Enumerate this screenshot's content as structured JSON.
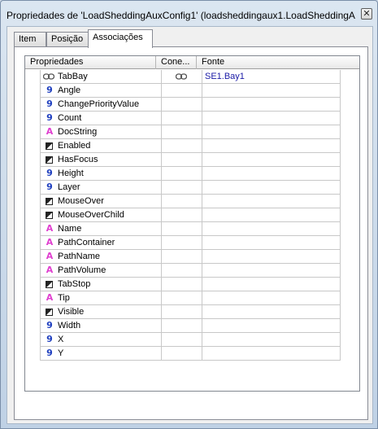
{
  "window": {
    "title": "Propriedades de 'LoadSheddingAuxConfig1' (loadsheddingaux1.LoadSheddingA...",
    "close_glyph": "✕"
  },
  "tabs": [
    {
      "label": "Item"
    },
    {
      "label": "Posição"
    },
    {
      "label": "Associações"
    }
  ],
  "grid": {
    "columns": [
      "Propriedades",
      "Cone...",
      "Fonte"
    ],
    "rows": [
      {
        "name": "TabBay",
        "icon": "link-icon",
        "connected": true,
        "source": "SE1.Bay1"
      },
      {
        "name": "Angle",
        "icon": "number-icon",
        "source": ""
      },
      {
        "name": "ChangePriorityValue",
        "icon": "number-icon",
        "source": ""
      },
      {
        "name": "Count",
        "icon": "number-icon",
        "source": ""
      },
      {
        "name": "DocString",
        "icon": "string-icon",
        "source": ""
      },
      {
        "name": "Enabled",
        "icon": "boolean-icon",
        "source": ""
      },
      {
        "name": "HasFocus",
        "icon": "boolean-icon",
        "source": ""
      },
      {
        "name": "Height",
        "icon": "number-icon",
        "source": ""
      },
      {
        "name": "Layer",
        "icon": "number-icon",
        "source": ""
      },
      {
        "name": "MouseOver",
        "icon": "boolean-icon",
        "source": ""
      },
      {
        "name": "MouseOverChild",
        "icon": "boolean-icon",
        "source": ""
      },
      {
        "name": "Name",
        "icon": "string-icon",
        "source": ""
      },
      {
        "name": "PathContainer",
        "icon": "string-icon",
        "source": ""
      },
      {
        "name": "PathName",
        "icon": "string-icon",
        "source": ""
      },
      {
        "name": "PathVolume",
        "icon": "string-icon",
        "source": ""
      },
      {
        "name": "TabStop",
        "icon": "boolean-icon",
        "source": ""
      },
      {
        "name": "Tip",
        "icon": "string-icon",
        "source": ""
      },
      {
        "name": "Visible",
        "icon": "boolean-icon",
        "source": ""
      },
      {
        "name": "Width",
        "icon": "number-icon",
        "source": ""
      },
      {
        "name": "X",
        "icon": "number-icon",
        "source": ""
      },
      {
        "name": "Y",
        "icon": "number-icon",
        "source": ""
      }
    ]
  },
  "icon_glyphs": {
    "number": "9",
    "string": "A"
  },
  "colors": {
    "number_icon": "#1f3fbf",
    "string_icon": "#e040d0",
    "source_text": "#1a1aa6"
  }
}
